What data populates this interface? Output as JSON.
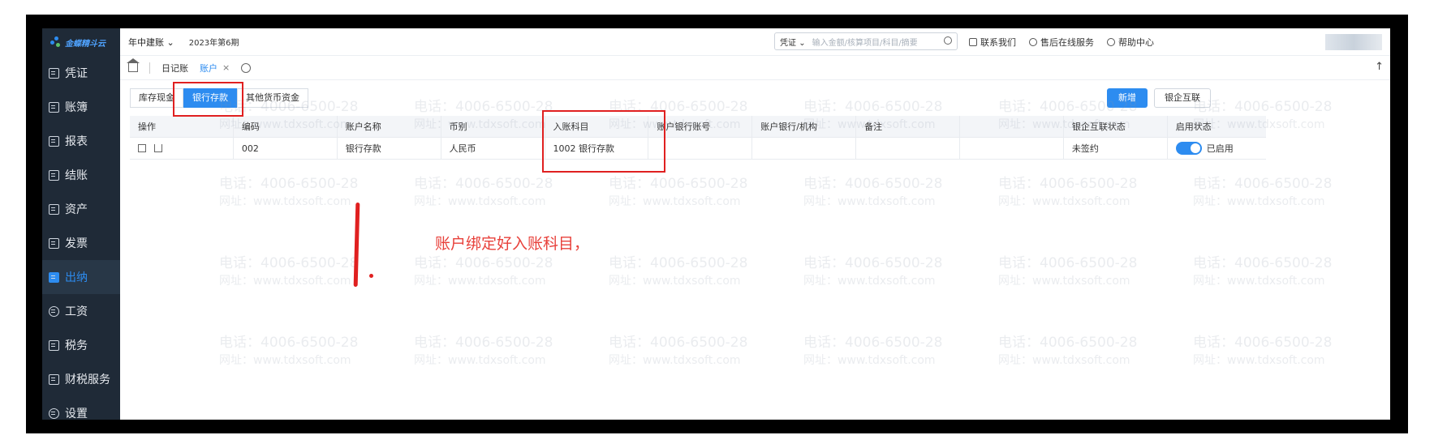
{
  "app": {
    "logo_text": "金蝶精斗云"
  },
  "sidebar": {
    "items": [
      {
        "label": "凭证"
      },
      {
        "label": "账簿"
      },
      {
        "label": "报表"
      },
      {
        "label": "结账"
      },
      {
        "label": "资产"
      },
      {
        "label": "发票"
      },
      {
        "label": "出纳",
        "active": true
      },
      {
        "label": "工资"
      },
      {
        "label": "税务"
      },
      {
        "label": "财税服务"
      },
      {
        "label": "设置"
      }
    ]
  },
  "topbar": {
    "book_name": "年中建账",
    "period": "2023年第6期",
    "search_type": "凭证",
    "search_placeholder": "输入金额/核算项目/科目/摘要",
    "contact": "联系我们",
    "after_sales": "售后在线服务",
    "help": "帮助中心"
  },
  "tabs": [
    {
      "label": "日记账"
    },
    {
      "label": "账户",
      "active": true
    }
  ],
  "subtabs": [
    {
      "label": "库存现金"
    },
    {
      "label": "银行存款",
      "active": true
    },
    {
      "label": "其他货币资金"
    }
  ],
  "buttons": {
    "new": "新增",
    "bank_connect": "银企互联"
  },
  "table": {
    "headers": [
      "操作",
      "编码",
      "账户名称",
      "币别",
      "入账科目",
      "账户银行账号",
      "账户银行/机构",
      "备注",
      "",
      "银企互联状态",
      "启用状态"
    ],
    "rows": [
      {
        "code": "002",
        "name": "银行存款",
        "currency": "人民币",
        "subject": "1002 银行存款",
        "account_no": "",
        "bank": "",
        "remark": "",
        "blank": "",
        "bank_status": "未签约",
        "enabled": "已启用"
      }
    ]
  },
  "annotation": {
    "text": "账户绑定好入账科目，"
  },
  "watermark": {
    "phone": "电话：4006-6500-28",
    "site": "网址：www.tdxsoft.com"
  },
  "colors": {
    "accent": "#2d8cf0",
    "sidebar_bg": "#1f2a37",
    "annotation": "#e02020"
  }
}
